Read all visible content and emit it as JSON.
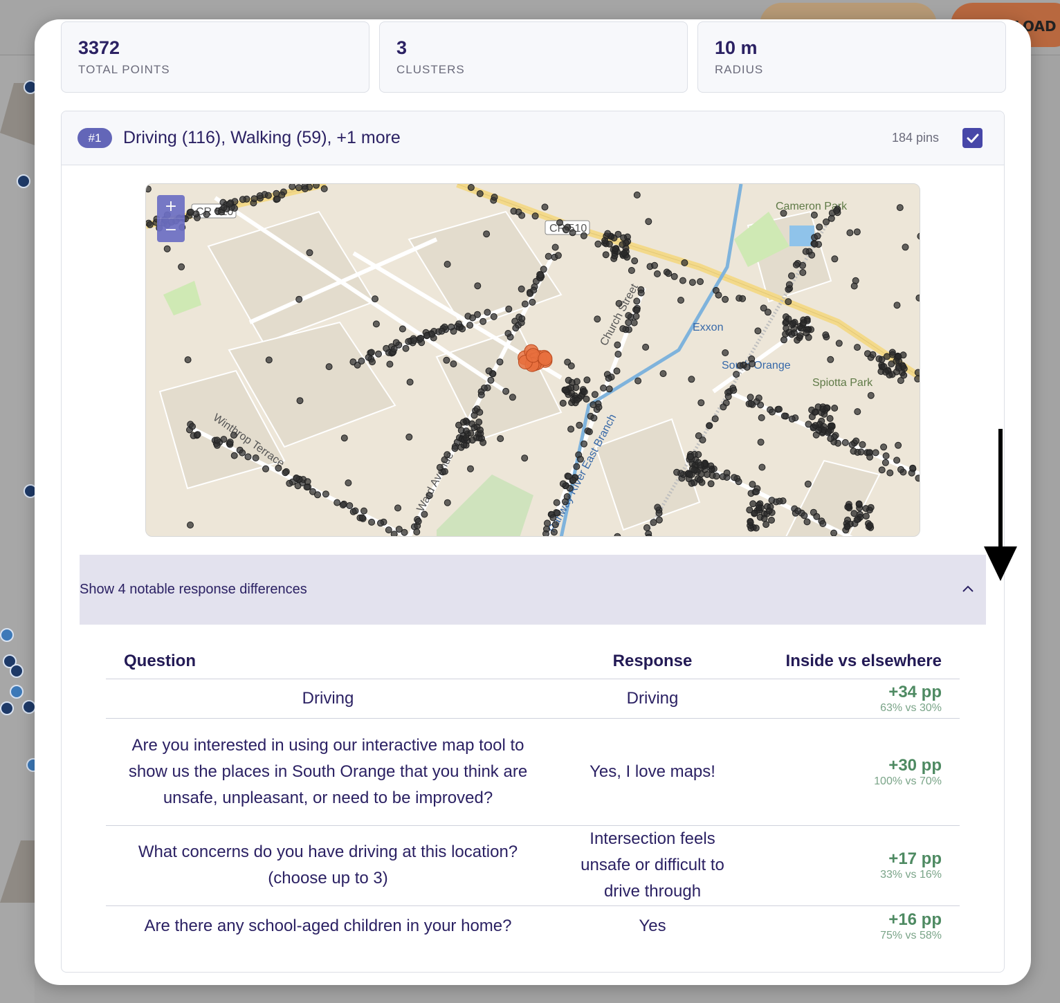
{
  "background": {
    "top_button_text": "LOAD"
  },
  "stats": [
    {
      "value": "3372",
      "label": "TOTAL POINTS"
    },
    {
      "value": "3",
      "label": "CLUSTERS"
    },
    {
      "value": "10 m",
      "label": "RADIUS"
    }
  ],
  "cluster": {
    "badge": "#1",
    "title": "Driving (116), Walking (59), +1 more",
    "pins": "184 pins",
    "checked": true
  },
  "map": {
    "zoom_in": "+",
    "zoom_out": "−",
    "labels": {
      "cr510_a": "CR 510",
      "cr510_b": "CR 510",
      "cameron_park": "Cameron Park",
      "exxon": "Exxon",
      "south_orange": "South Orange",
      "spiotta_park": "Spiotta Park",
      "winthrop": "Winthrop Terrace",
      "rahway": "Rahway River East Branch",
      "ward": "Ward Avenue",
      "church": "Church Street"
    }
  },
  "differences": {
    "toggle_label": "Show 4 notable response differences",
    "headers": {
      "question": "Question",
      "response": "Response",
      "delta": "Inside vs elsewhere"
    },
    "rows": [
      {
        "question": "Driving",
        "response": "Driving",
        "delta": "+34 pp",
        "compare": "63% vs 30%"
      },
      {
        "question": "Are you interested in using our interactive map tool to show us the places in South Orange that you think are unsafe, unpleasant, or need to be improved?",
        "response": "Yes, I love maps!",
        "delta": "+30 pp",
        "compare": "100% vs 70%"
      },
      {
        "question": "What concerns do you have driving at this location? (choose up to 3)",
        "response": "Intersection feels unsafe or difficult to drive through",
        "delta": "+17 pp",
        "compare": "33% vs 16%"
      },
      {
        "question": "Are there any school-aged children in your home?",
        "response": "Yes",
        "delta": "+16 pp",
        "compare": "75% vs 58%"
      }
    ]
  },
  "colors": {
    "accent": "#4747a8",
    "badge": "#6366b8",
    "positive": "#4e8a62",
    "highlight_cluster": "#e8703e"
  }
}
